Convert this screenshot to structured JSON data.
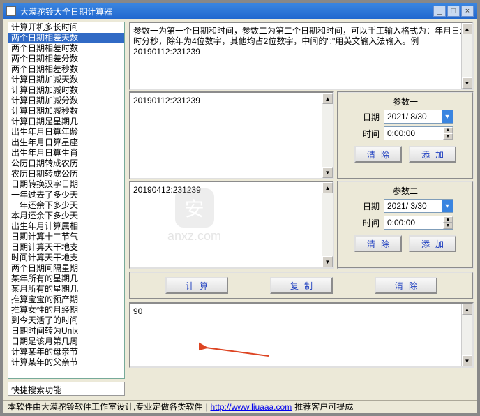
{
  "window": {
    "title": "大漠驼铃大全日期计算器",
    "min": "_",
    "max": "□",
    "close": "×"
  },
  "sidebar": {
    "items": [
      "计算开机多长时间",
      "两个日期相差天数",
      "两个日期相差时数",
      "两个日期相差分数",
      "两个日期相差秒数",
      "计算日期加减天数",
      "计算日期加减时数",
      "计算日期加减分数",
      "计算日期加减秒数",
      "计算日期是星期几",
      "出生年月日算年龄",
      "出生年月日算星座",
      "出生年月日算生肖",
      "公历日期转成农历",
      "农历日期转成公历",
      "日期转换汉字日期",
      "一年过去了多少天",
      "一年还余下多少天",
      "本月还余下多少天",
      "出生年月计算属相",
      "日期计算十二节气",
      "日期计算天干地支",
      "时间计算天干地支",
      "两个日期间隔星期",
      "某年所有的星期几",
      "某月所有的星期几",
      "推算宝宝的预产期",
      "推算女性的月经期",
      "到今天活了的时间",
      "日期时间转为Unix",
      "日期是该月第几周",
      "计算某年的母亲节",
      "计算某年的父亲节"
    ],
    "selected_index": 1
  },
  "quick_search": "快捷搜索功能",
  "instructions": "参数一为第一个日期和时间，参数二为第二个日期和时间，可以手工输入格式为：年月日:时分秒，除年为4位数字，其他均占2位数字，中间的\":\"用英文输入法输入。例20190112:231239",
  "param1": {
    "title": "参数一",
    "textarea": "20190112:231239",
    "date_label": "日期",
    "date_value": "2021/ 8/30",
    "time_label": "时间",
    "time_value": " 0:00:00",
    "clear": "清除",
    "add": "添加"
  },
  "param2": {
    "title": "参数二",
    "textarea": "20190412:231239",
    "date_label": "日期",
    "date_value": "2021/ 3/30",
    "time_label": "时间",
    "time_value": " 0:00:00",
    "clear": "清除",
    "add": "添加"
  },
  "actions": {
    "calc": "计算",
    "copy": "复制",
    "clear": "清除"
  },
  "result": "90",
  "statusbar": {
    "text1": "本软件由大漠驼铃软件工作室设计,专业定做各类软件",
    "url": "http://www.liuaaa.com",
    "text2": "推荐客户可提成"
  },
  "watermark": {
    "icon": "安",
    "text": "anxz.com"
  }
}
